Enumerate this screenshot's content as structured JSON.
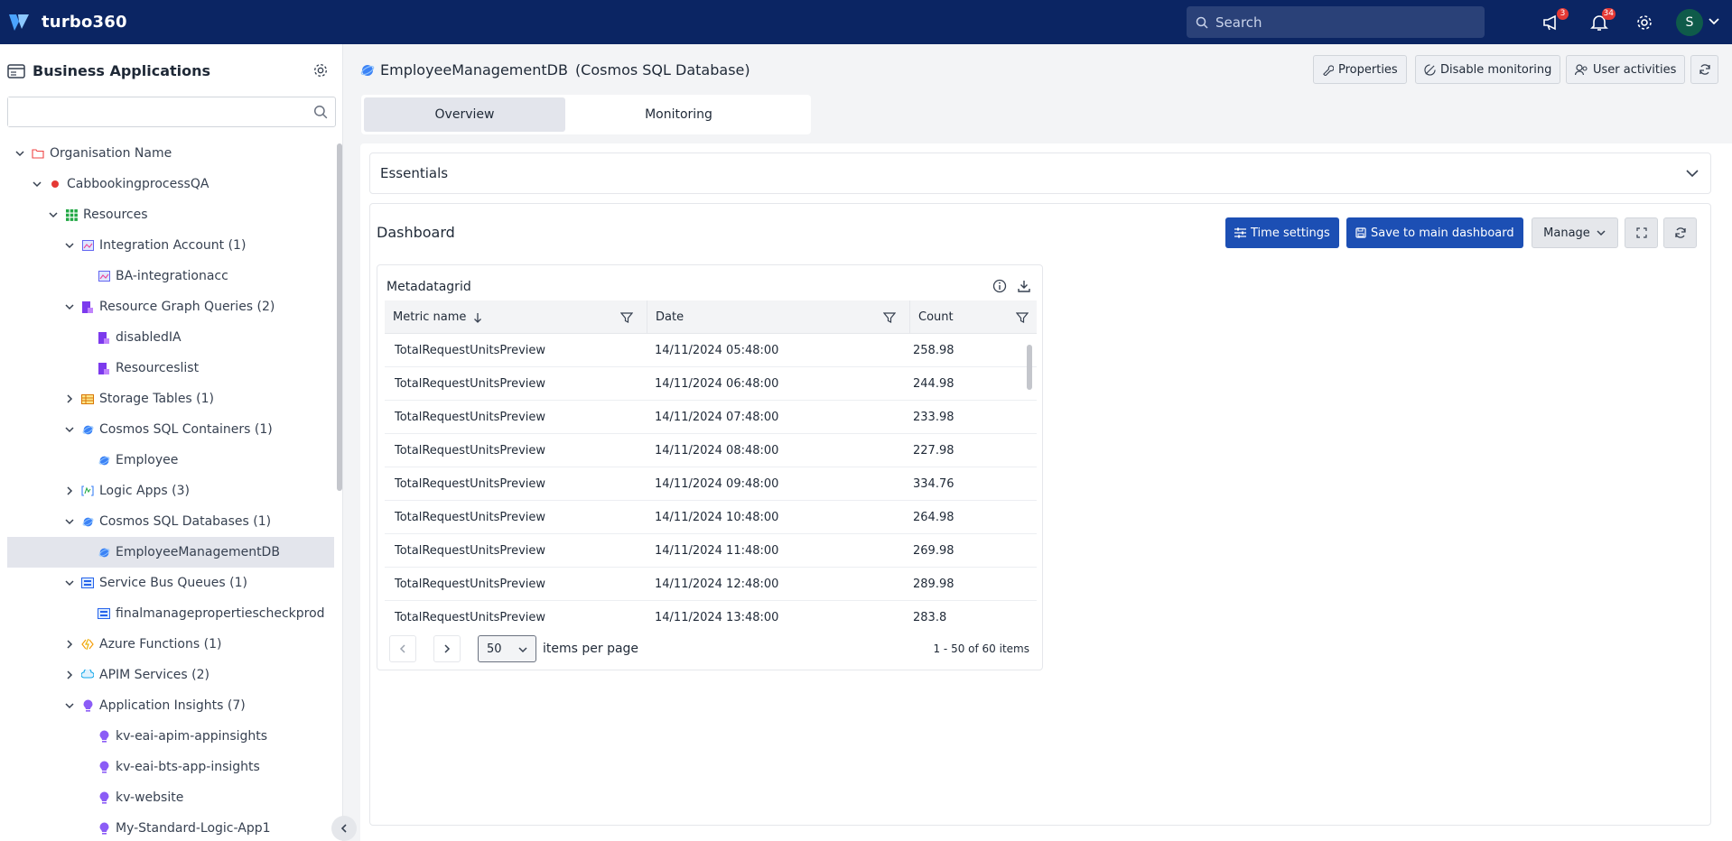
{
  "app": {
    "name": "turbo360",
    "search_placeholder": "Search",
    "announcements_count": "3",
    "notifications_count": "34",
    "user_initial": "S"
  },
  "sidebar": {
    "title": "Business Applications",
    "search_value": "",
    "tree": [
      {
        "label": "Organisation Name",
        "depth": 0,
        "chevron": "down",
        "icon": "folder-icon"
      },
      {
        "label": "CabbookingprocessQA",
        "depth": 1,
        "chevron": "down",
        "icon": "status-dot-icon"
      },
      {
        "label": "Resources",
        "depth": 2,
        "chevron": "down",
        "icon": "grid-icon"
      },
      {
        "label": "Integration Account (1)",
        "depth": 3,
        "chevron": "down",
        "icon": "integration-account-icon"
      },
      {
        "label": "BA-integrationacc",
        "depth": 4,
        "chevron": "",
        "icon": "integration-account-icon"
      },
      {
        "label": "Resource Graph Queries (2)",
        "depth": 3,
        "chevron": "down",
        "icon": "resource-graph-icon"
      },
      {
        "label": "disabledIA",
        "depth": 4,
        "chevron": "",
        "icon": "resource-graph-icon"
      },
      {
        "label": "Resourceslist",
        "depth": 4,
        "chevron": "",
        "icon": "resource-graph-icon"
      },
      {
        "label": "Storage Tables (1)",
        "depth": 3,
        "chevron": "right",
        "icon": "storage-table-icon"
      },
      {
        "label": "Cosmos SQL Containers (1)",
        "depth": 3,
        "chevron": "down",
        "icon": "cosmos-icon"
      },
      {
        "label": "Employee",
        "depth": 4,
        "chevron": "",
        "icon": "cosmos-icon"
      },
      {
        "label": "Logic Apps (3)",
        "depth": 3,
        "chevron": "right",
        "icon": "logic-app-icon"
      },
      {
        "label": "Cosmos SQL Databases (1)",
        "depth": 3,
        "chevron": "down",
        "icon": "cosmos-icon"
      },
      {
        "label": "EmployeeManagementDB",
        "depth": 4,
        "chevron": "",
        "icon": "cosmos-icon",
        "selected": true
      },
      {
        "label": "Service Bus Queues (1)",
        "depth": 3,
        "chevron": "down",
        "icon": "service-bus-icon"
      },
      {
        "label": "finalmanagepropertiescheckprod",
        "depth": 4,
        "chevron": "",
        "icon": "service-bus-icon"
      },
      {
        "label": "Azure Functions (1)",
        "depth": 3,
        "chevron": "right",
        "icon": "function-icon"
      },
      {
        "label": "APIM Services (2)",
        "depth": 3,
        "chevron": "right",
        "icon": "apim-icon"
      },
      {
        "label": "Application Insights (7)",
        "depth": 3,
        "chevron": "down",
        "icon": "app-insights-icon"
      },
      {
        "label": "kv-eai-apim-appinsights",
        "depth": 4,
        "chevron": "",
        "icon": "app-insights-icon"
      },
      {
        "label": "kv-eai-bts-app-insights",
        "depth": 4,
        "chevron": "",
        "icon": "app-insights-icon"
      },
      {
        "label": "kv-website",
        "depth": 4,
        "chevron": "",
        "icon": "app-insights-icon"
      },
      {
        "label": "My-Standard-Logic-App1",
        "depth": 4,
        "chevron": "",
        "icon": "app-insights-icon"
      }
    ]
  },
  "resource": {
    "name": "EmployeeManagementDB",
    "type": "(Cosmos SQL Database)"
  },
  "header_buttons": {
    "properties": "Properties",
    "disable_monitoring": "Disable monitoring",
    "user_activities": "User activities"
  },
  "tabs": [
    "Overview",
    "Monitoring"
  ],
  "essentials": {
    "label": "Essentials"
  },
  "dashboard": {
    "title": "Dashboard",
    "time_settings": "Time settings",
    "save_to_main": "Save to main dashboard",
    "manage": "Manage"
  },
  "widget": {
    "title": "Metadatagrid",
    "columns": [
      "Metric name",
      "Date",
      "Count"
    ],
    "rows": [
      [
        "TotalRequestUnitsPreview",
        "14/11/2024 05:48:00",
        "258.98"
      ],
      [
        "TotalRequestUnitsPreview",
        "14/11/2024 06:48:00",
        "244.98"
      ],
      [
        "TotalRequestUnitsPreview",
        "14/11/2024 07:48:00",
        "233.98"
      ],
      [
        "TotalRequestUnitsPreview",
        "14/11/2024 08:48:00",
        "227.98"
      ],
      [
        "TotalRequestUnitsPreview",
        "14/11/2024 09:48:00",
        "334.76"
      ],
      [
        "TotalRequestUnitsPreview",
        "14/11/2024 10:48:00",
        "264.98"
      ],
      [
        "TotalRequestUnitsPreview",
        "14/11/2024 11:48:00",
        "269.98"
      ],
      [
        "TotalRequestUnitsPreview",
        "14/11/2024 12:48:00",
        "289.98"
      ],
      [
        "TotalRequestUnitsPreview",
        "14/11/2024 13:48:00",
        "283.8"
      ]
    ],
    "page_size": "50",
    "items_per_page": "items per page",
    "page_info": "1 - 50 of 60 items"
  },
  "colors": {
    "topbar": "#0b2563",
    "primary": "#1c4fb4",
    "badge": "#e53935"
  }
}
